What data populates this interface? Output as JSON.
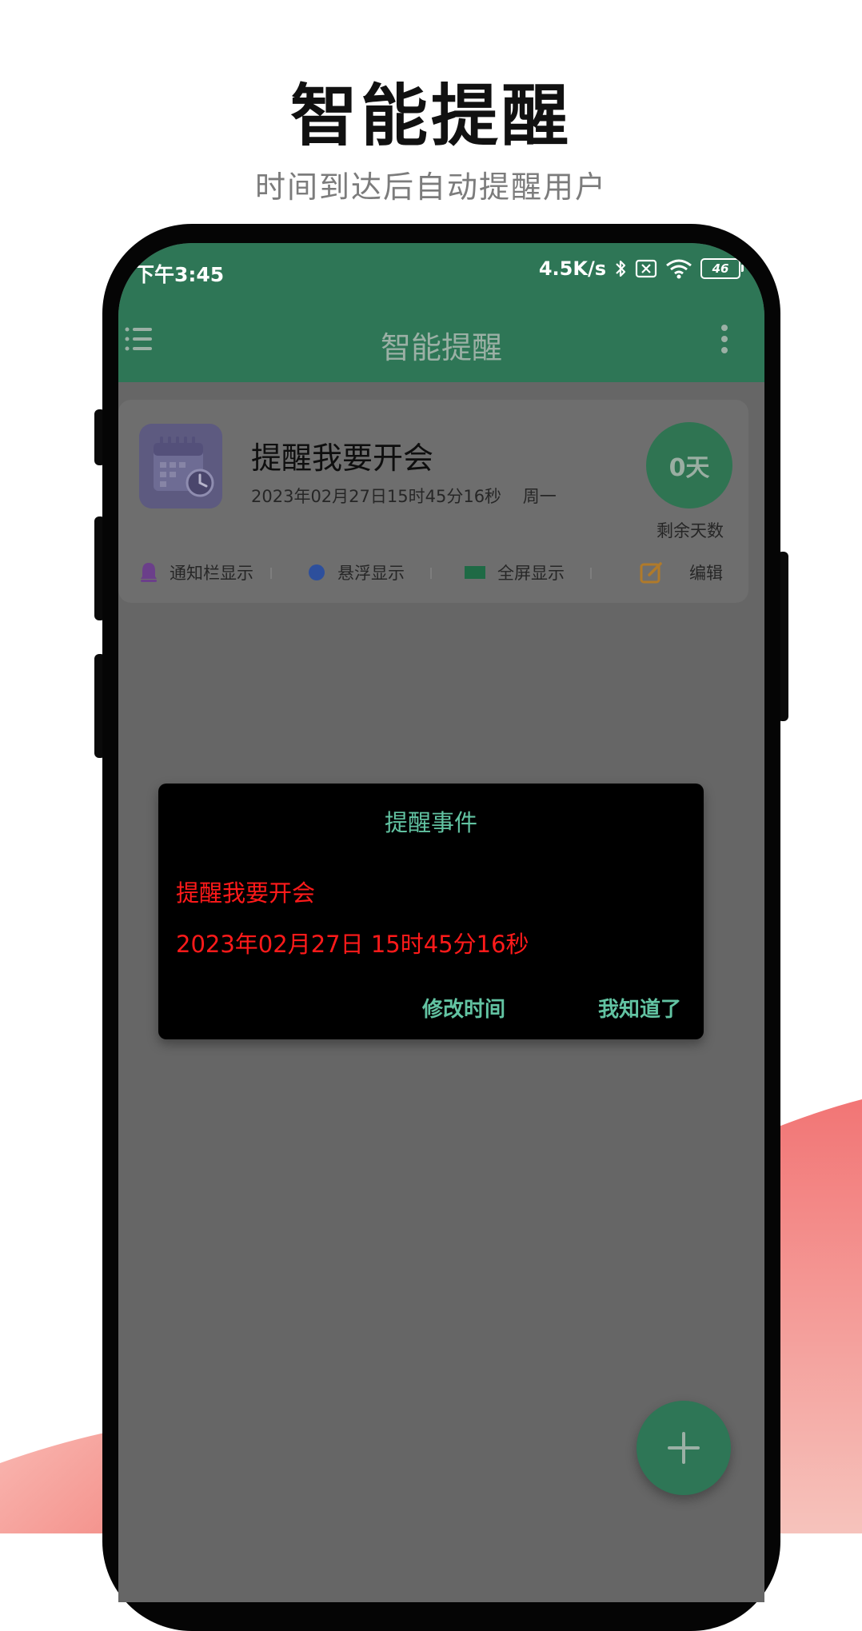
{
  "promo": {
    "title": "智能提醒",
    "subtitle": "时间到达后自动提醒用户"
  },
  "status_bar": {
    "time": "下午3:45",
    "network_speed": "4.5K/s",
    "battery": "46",
    "icons": [
      "bluetooth-icon",
      "sim-disabled-icon",
      "wifi-icon",
      "battery-icon"
    ]
  },
  "toolbar": {
    "title": "智能提醒",
    "left_icon": "menu-icon",
    "right_icon": "more-vertical-icon"
  },
  "reminder_card": {
    "title": "提醒我要开会",
    "datetime": "2023年02月27日15时45分16秒",
    "weekday": "周一",
    "days_value": "0天",
    "days_label": "剩余天数",
    "actions": [
      {
        "label": "通知栏显示",
        "icon": "bell-icon",
        "color": "#6b3f8a"
      },
      {
        "label": "悬浮显示",
        "icon": "circle-icon",
        "color": "#2d4f9c"
      },
      {
        "label": "全屏显示",
        "icon": "rectangle-icon",
        "color": "#1f6a45"
      },
      {
        "label": "编辑",
        "icon": "edit-icon",
        "color": "#b07a2a"
      }
    ]
  },
  "dialog": {
    "title": "提醒事件",
    "event": "提醒我要开会",
    "time": "2023年02月27日 15时45分16秒",
    "modify_label": "修改时间",
    "ok_label": "我知道了"
  },
  "fab": {
    "icon": "plus-icon"
  },
  "colors": {
    "primary": "#2e7656",
    "accent_text": "#62c3a2",
    "alert_text": "#ff1a1a",
    "overlay_screen": "#666666",
    "decor_red": "#f07070"
  }
}
